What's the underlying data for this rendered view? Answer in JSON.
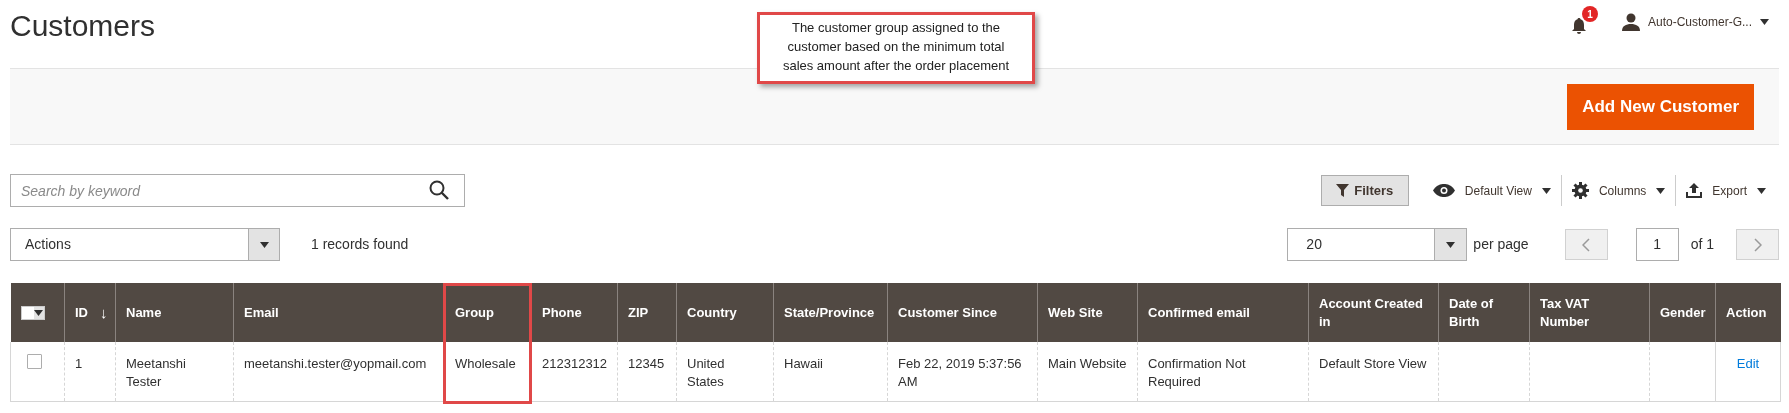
{
  "page_title": "Customers",
  "callout": {
    "text": "The customer group assigned to the customer based on the minimum total sales amount after the order placement"
  },
  "notifications": {
    "count": "1"
  },
  "user": {
    "name": "Auto-Customer-G..."
  },
  "add_button": "Add New Customer",
  "search": {
    "placeholder": "Search by keyword"
  },
  "toolbar": {
    "filters": "Filters",
    "view": "Default View",
    "columns": "Columns",
    "export": "Export"
  },
  "actions": {
    "label": "Actions"
  },
  "records_found": "1 records found",
  "pager": {
    "per_page_value": "20",
    "per_page_label": "per page",
    "page": "1",
    "of": "of 1"
  },
  "table": {
    "sort_arrow": "↓",
    "columns": [
      {
        "kind": "checkbox",
        "highlighted": false
      },
      {
        "label": "ID",
        "kind": "sorted",
        "highlighted": false
      },
      {
        "label": "Name",
        "kind": "text",
        "highlighted": false
      },
      {
        "label": "Email",
        "kind": "text",
        "highlighted": false
      },
      {
        "label": "Group",
        "kind": "text",
        "highlighted": true
      },
      {
        "label": "Phone",
        "kind": "text",
        "highlighted": false
      },
      {
        "label": "ZIP",
        "kind": "text",
        "highlighted": false
      },
      {
        "label": "Country",
        "kind": "text",
        "highlighted": false
      },
      {
        "label": "State/Province",
        "kind": "text",
        "highlighted": false
      },
      {
        "label": "Customer Since",
        "kind": "text",
        "highlighted": false
      },
      {
        "label": "Web Site",
        "kind": "text",
        "highlighted": false
      },
      {
        "label": "Confirmed email",
        "kind": "text",
        "highlighted": false
      },
      {
        "label": "Account Created in",
        "kind": "text",
        "highlighted": false
      },
      {
        "label": "Date of Birth",
        "kind": "text",
        "highlighted": false
      },
      {
        "label": "Tax VAT Number",
        "kind": "text",
        "highlighted": false
      },
      {
        "label": "Gender",
        "kind": "text",
        "highlighted": false
      },
      {
        "label": "Action",
        "kind": "text",
        "highlighted": false
      }
    ],
    "rows": [
      {
        "checked": false,
        "cells": [
          "",
          "1",
          "Meetanshi Tester",
          "meetanshi.tester@yopmail.com",
          "Wholesale",
          "212312312",
          "12345",
          "United States",
          "Hawaii",
          "Feb 22, 2019 5:37:56 AM",
          "Main Website",
          "Confirmation Not Required",
          "Default Store View",
          "",
          "",
          "",
          "Edit"
        ]
      }
    ]
  }
}
